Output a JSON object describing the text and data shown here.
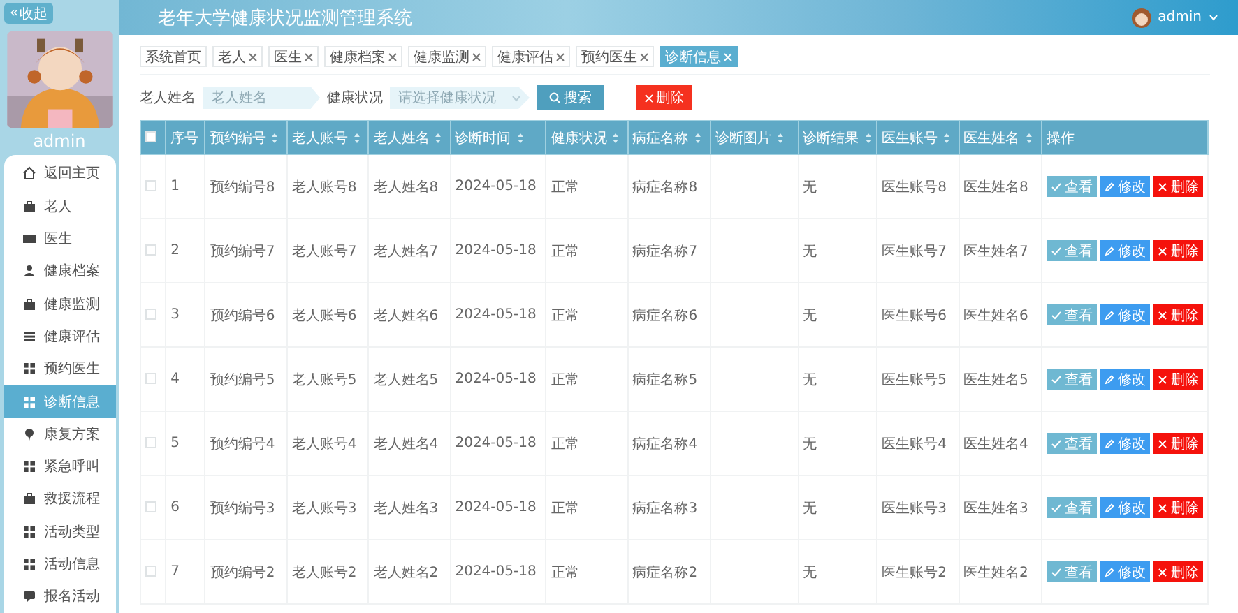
{
  "sidebar": {
    "collapse_button": {
      "icon": "«",
      "label": "收起"
    },
    "user": "admin",
    "items": [
      {
        "label": "返回主页",
        "selected": false
      },
      {
        "label": "老人",
        "selected": false
      },
      {
        "label": "医生",
        "selected": false
      },
      {
        "label": "健康档案",
        "selected": false
      },
      {
        "label": "健康监测",
        "selected": false
      },
      {
        "label": "健康评估",
        "selected": false
      },
      {
        "label": "预约医生",
        "selected": false
      },
      {
        "label": "诊断信息",
        "selected": true
      },
      {
        "label": "康复方案",
        "selected": false
      },
      {
        "label": "紧急呼叫",
        "selected": false
      },
      {
        "label": "救援流程",
        "selected": false
      },
      {
        "label": "活动类型",
        "selected": false
      },
      {
        "label": "活动信息",
        "selected": false
      },
      {
        "label": "报名活动",
        "selected": false
      }
    ]
  },
  "header": {
    "title": "老年大学健康状况监测管理系统",
    "user": "admin"
  },
  "tabs": [
    {
      "label": "系统首页",
      "closable": false,
      "selected": false
    },
    {
      "label": "老人",
      "closable": true,
      "selected": false
    },
    {
      "label": "医生",
      "closable": true,
      "selected": false
    },
    {
      "label": "健康档案",
      "closable": true,
      "selected": false
    },
    {
      "label": "健康监测",
      "closable": true,
      "selected": false
    },
    {
      "label": "健康评估",
      "closable": true,
      "selected": false
    },
    {
      "label": "预约医生",
      "closable": true,
      "selected": false
    },
    {
      "label": "诊断信息",
      "closable": true,
      "selected": true
    }
  ],
  "search": {
    "fields": [
      {
        "label": "老人姓名",
        "kind": "input",
        "placeholder": "老人姓名"
      },
      {
        "label": "健康状况",
        "kind": "select",
        "placeholder": "请选择健康状况"
      }
    ],
    "search_button": "搜索",
    "delete_button": "删除"
  },
  "table": {
    "select_all": {
      "checked": false
    },
    "columns": [
      {
        "label": "序号",
        "sortable": false
      },
      {
        "label": "预约编号",
        "sortable": true
      },
      {
        "label": "老人账号",
        "sortable": true
      },
      {
        "label": "老人姓名",
        "sortable": true
      },
      {
        "label": "诊断时间",
        "sortable": true
      },
      {
        "label": "健康状况",
        "sortable": true
      },
      {
        "label": "病症名称",
        "sortable": true
      },
      {
        "label": "诊断图片",
        "sortable": true
      },
      {
        "label": "诊断结果",
        "sortable": true
      },
      {
        "label": "医生账号",
        "sortable": true
      },
      {
        "label": "医生姓名",
        "sortable": true
      },
      {
        "label": "操作",
        "sortable": false
      }
    ],
    "rows": [
      {
        "checked": false,
        "cells": [
          "1",
          "预约编号8",
          "老人账号8",
          "老人姓名8",
          "2024-05-18",
          "正常",
          "病症名称8",
          "",
          "无",
          "医生账号8",
          "医生姓名8"
        ],
        "actions": [
          {
            "kind": "view",
            "label": "查看"
          },
          {
            "kind": "edit",
            "label": "修改"
          },
          {
            "kind": "delete",
            "label": "删除"
          }
        ]
      },
      {
        "checked": false,
        "cells": [
          "2",
          "预约编号7",
          "老人账号7",
          "老人姓名7",
          "2024-05-18",
          "正常",
          "病症名称7",
          "",
          "无",
          "医生账号7",
          "医生姓名7"
        ],
        "actions": [
          {
            "kind": "view",
            "label": "查看"
          },
          {
            "kind": "edit",
            "label": "修改"
          },
          {
            "kind": "delete",
            "label": "删除"
          }
        ]
      },
      {
        "checked": false,
        "cells": [
          "3",
          "预约编号6",
          "老人账号6",
          "老人姓名6",
          "2024-05-18",
          "正常",
          "病症名称6",
          "",
          "无",
          "医生账号6",
          "医生姓名6"
        ],
        "actions": [
          {
            "kind": "view",
            "label": "查看"
          },
          {
            "kind": "edit",
            "label": "修改"
          },
          {
            "kind": "delete",
            "label": "删除"
          }
        ]
      },
      {
        "checked": false,
        "cells": [
          "4",
          "预约编号5",
          "老人账号5",
          "老人姓名5",
          "2024-05-18",
          "正常",
          "病症名称5",
          "",
          "无",
          "医生账号5",
          "医生姓名5"
        ],
        "actions": [
          {
            "kind": "view",
            "label": "查看"
          },
          {
            "kind": "edit",
            "label": "修改"
          },
          {
            "kind": "delete",
            "label": "删除"
          }
        ]
      },
      {
        "checked": false,
        "cells": [
          "5",
          "预约编号4",
          "老人账号4",
          "老人姓名4",
          "2024-05-18",
          "正常",
          "病症名称4",
          "",
          "无",
          "医生账号4",
          "医生姓名4"
        ],
        "actions": [
          {
            "kind": "view",
            "label": "查看"
          },
          {
            "kind": "edit",
            "label": "修改"
          },
          {
            "kind": "delete",
            "label": "删除"
          }
        ]
      },
      {
        "checked": false,
        "cells": [
          "6",
          "预约编号3",
          "老人账号3",
          "老人姓名3",
          "2024-05-18",
          "正常",
          "病症名称3",
          "",
          "无",
          "医生账号3",
          "医生姓名3"
        ],
        "actions": [
          {
            "kind": "view",
            "label": "查看"
          },
          {
            "kind": "edit",
            "label": "修改"
          },
          {
            "kind": "delete",
            "label": "删除"
          }
        ]
      },
      {
        "checked": false,
        "cells": [
          "7",
          "预约编号2",
          "老人账号2",
          "老人姓名2",
          "2024-05-18",
          "正常",
          "病症名称2",
          "",
          "无",
          "医生账号2",
          "医生姓名2"
        ],
        "actions": [
          {
            "kind": "view",
            "label": "查看"
          },
          {
            "kind": "edit",
            "label": "修改"
          },
          {
            "kind": "delete",
            "label": "删除"
          }
        ]
      }
    ]
  }
}
